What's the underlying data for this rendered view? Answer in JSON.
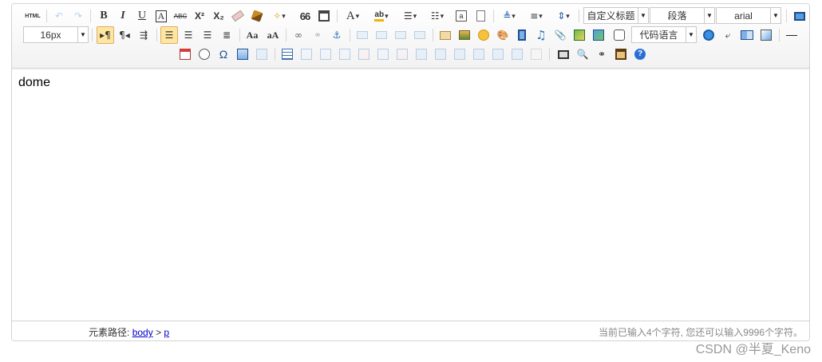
{
  "toolbar": {
    "row1": {
      "source_label": "HTML",
      "bold_label": "B",
      "italic_label": "I",
      "underline_label": "U",
      "fontborder_label": "A",
      "strike_label": "ABC",
      "superscript_label": "X²",
      "subscript_label": "X₂",
      "blockquote_label": "66",
      "forecolor_label": "A",
      "backcolor_label": "ab",
      "custom_heading_value": "自定义标题",
      "paragraph_value": "段落",
      "font_family_value": "arial"
    },
    "row2": {
      "font_size_value": "16px",
      "code_language_value": "代码语言"
    },
    "row3": {
      "omega_label": "Ω"
    }
  },
  "content": {
    "text": "dome"
  },
  "statusbar": {
    "path_label": "元素路径:",
    "path_body": "body",
    "path_sep": ">",
    "path_p": "p",
    "word_count": "当前已输入4个字符, 您还可以输入9996个字符。"
  },
  "watermark": "CSDN @半夏_Keno",
  "colors": {
    "active_bg": "#ffe69f",
    "link": "#0000cc",
    "toolbar_bg": "#f2f2f2"
  }
}
